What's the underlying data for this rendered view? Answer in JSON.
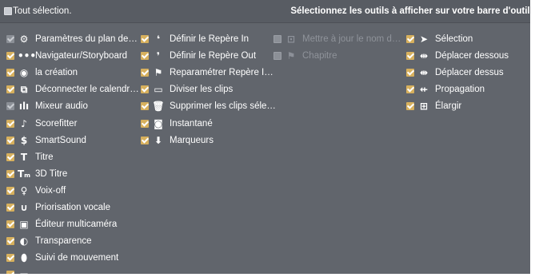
{
  "header": {
    "select_all_label": "Tout sélection.",
    "instructions": "Sélectionnez les outils à afficher sur votre barre d'outils"
  },
  "columns": [
    [
      {
        "label": "Paramètres du plan de…",
        "state": "disabled",
        "icon": "gear-icon",
        "glyph": "⚙"
      },
      {
        "label": "Navigateur/Storyboard",
        "state": "checked",
        "icon": "dots-icon",
        "glyph": "•••"
      },
      {
        "label": "la création",
        "state": "checked",
        "icon": "create-disc-icon",
        "glyph": "◉"
      },
      {
        "label": "Déconnecter le calendr…",
        "state": "checked",
        "icon": "disconnect-timeline-icon",
        "glyph": "⧉"
      },
      {
        "label": "Mixeur audio",
        "state": "disabled",
        "icon": "audio-mixer-icon",
        "glyph": "ılı"
      },
      {
        "label": "Scorefitter",
        "state": "checked",
        "icon": "scorefitter-icon",
        "glyph": "♪"
      },
      {
        "label": "SmartSound",
        "state": "checked",
        "icon": "smartsound-icon",
        "glyph": "$"
      },
      {
        "label": "Titre",
        "state": "checked",
        "icon": "title-icon",
        "glyph": "T"
      },
      {
        "label": "3D Titre",
        "state": "checked",
        "icon": "title-3d-icon",
        "glyph": "Tₘ"
      },
      {
        "label": "Voix-off",
        "state": "checked",
        "icon": "microphone-icon",
        "glyph": "♀"
      },
      {
        "label": "Priorisation vocale",
        "state": "checked",
        "icon": "voice-ducking-icon",
        "glyph": "∪"
      },
      {
        "label": "Éditeur multicaméra",
        "state": "checked",
        "icon": "multicam-icon",
        "glyph": "▣"
      },
      {
        "label": "Transparence",
        "state": "checked",
        "icon": "transparency-icon",
        "glyph": "◐"
      },
      {
        "label": "Suivi de mouvement",
        "state": "checked",
        "icon": "motion-tracking-icon",
        "glyph": "⬮"
      },
      {
        "label": "",
        "state": "checked",
        "icon": "partial-icon",
        "glyph": "▬"
      }
    ],
    [
      {
        "label": "Définir le Repère In",
        "state": "checked",
        "icon": "mark-in-icon",
        "glyph": "❛"
      },
      {
        "label": "Définir le Repère Out",
        "state": "checked",
        "icon": "mark-out-icon",
        "glyph": "❜"
      },
      {
        "label": "Reparamétrer Repère I…",
        "state": "checked",
        "icon": "reset-marks-icon",
        "glyph": "⚑"
      },
      {
        "label": "Diviser les clips",
        "state": "checked",
        "icon": "split-clip-icon",
        "glyph": "▭"
      },
      {
        "label": "Supprimer les clips séle…",
        "state": "checked",
        "icon": "trash-icon",
        "glyph": "🗑"
      },
      {
        "label": "Instantané",
        "state": "checked",
        "icon": "camera-icon",
        "glyph": "◙"
      },
      {
        "label": "Marqueurs",
        "state": "checked",
        "icon": "marker-icon",
        "glyph": "⬇"
      }
    ],
    [
      {
        "label": "Mettre à jour le nom d…",
        "state": "off",
        "icon": "rename-icon",
        "glyph": "⊡"
      },
      {
        "label": "Chapitre",
        "state": "off",
        "icon": "chapter-flag-icon",
        "glyph": "⚑"
      }
    ],
    [
      {
        "label": "Sélection",
        "state": "checked",
        "icon": "cursor-icon",
        "glyph": "➤"
      },
      {
        "label": "Déplacer dessous",
        "state": "checked",
        "icon": "move-under-icon",
        "glyph": "⇹"
      },
      {
        "label": "Déplacer dessus",
        "state": "checked",
        "icon": "move-over-icon",
        "glyph": "⇼"
      },
      {
        "label": "Propagation",
        "state": "checked",
        "icon": "ripple-icon",
        "glyph": "⇷"
      },
      {
        "label": "Élargir",
        "state": "checked",
        "icon": "stretch-icon",
        "glyph": "⊞"
      }
    ]
  ]
}
